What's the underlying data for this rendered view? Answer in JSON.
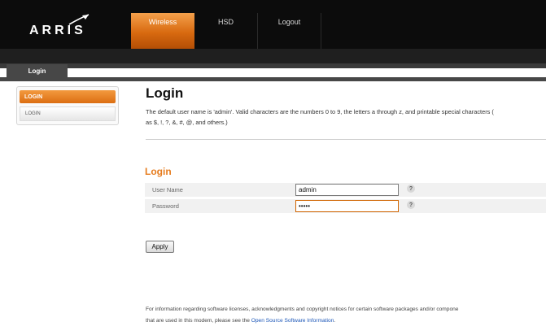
{
  "header": {
    "logo_text": "ARRIS",
    "nav": [
      {
        "label": "Wireless",
        "active": true
      },
      {
        "label": "HSD",
        "active": false
      },
      {
        "label": "Logout",
        "active": false
      }
    ]
  },
  "subnav": {
    "tab_label": "Login"
  },
  "sidebar": {
    "head_label": "LOGIN",
    "items": [
      {
        "label": "LOGIN"
      }
    ]
  },
  "main": {
    "title": "Login",
    "description_line1": "The default user name is 'admin'. Valid characters are the numbers 0 to 9, the letters a through z, and printable special characters (",
    "description_line2": "as $, !, ?, &, #, @, and others.)",
    "section_title": "Login",
    "fields": {
      "username": {
        "label": "User Name",
        "value": "admin",
        "help": "?"
      },
      "password": {
        "label": "Password",
        "value": "•••••",
        "help": "?"
      }
    },
    "apply_label": "Apply"
  },
  "footer": {
    "line1": "For information regarding software licenses, acknowledgments and copyright notices for certain software packages and/or compone",
    "line2_prefix": "that are used in this modem, please see the ",
    "line2_link": "Open Source Software Information",
    "line2_suffix": "."
  },
  "colors": {
    "accent_orange": "#e67c1e",
    "header_bg": "#0c0c0c",
    "link_blue": "#1d57b8"
  }
}
